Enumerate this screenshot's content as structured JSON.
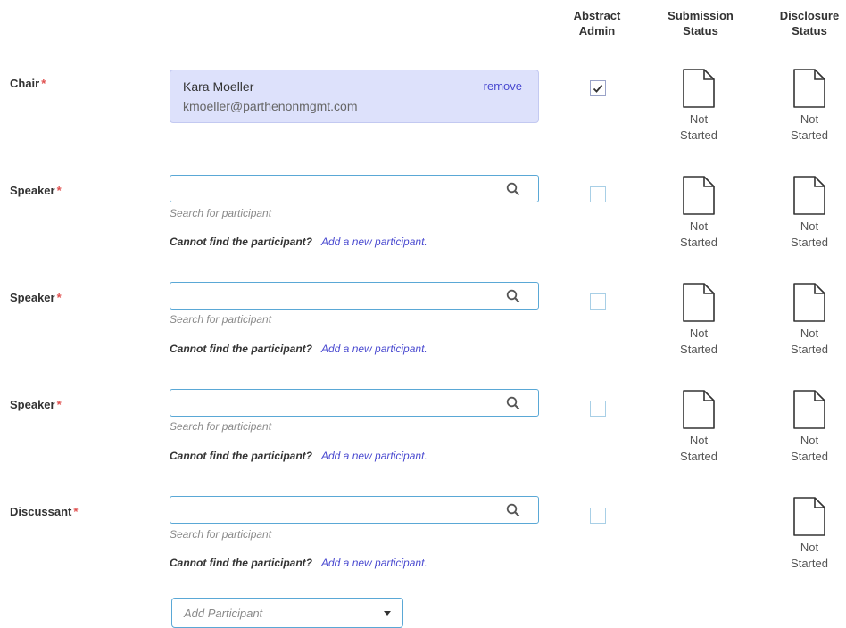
{
  "columns": {
    "abstract_admin": "Abstract\nAdmin",
    "submission_status": "Submission\nStatus",
    "disclosure_status": "Disclosure\nStatus"
  },
  "required_mark": "*",
  "chair": {
    "label": "Chair",
    "name": "Kara Moeller",
    "email": "kmoeller@parthenonmgmt.com",
    "remove_label": "remove",
    "abstract_admin_checked": true,
    "submission_status": "Not\nStarted",
    "disclosure_status": "Not\nStarted"
  },
  "slots": [
    {
      "label": "Speaker",
      "search_value": "",
      "hint": "Search for participant",
      "cannot_find": "Cannot find the participant?",
      "add_new": "Add a new participant.",
      "abstract_admin_checked": false,
      "submission_status": "Not\nStarted",
      "disclosure_status": "Not\nStarted"
    },
    {
      "label": "Speaker",
      "search_value": "",
      "hint": "Search for participant",
      "cannot_find": "Cannot find the participant?",
      "add_new": "Add a new participant.",
      "abstract_admin_checked": false,
      "submission_status": "Not\nStarted",
      "disclosure_status": "Not\nStarted"
    },
    {
      "label": "Speaker",
      "search_value": "",
      "hint": "Search for participant",
      "cannot_find": "Cannot find the participant?",
      "add_new": "Add a new participant.",
      "abstract_admin_checked": false,
      "submission_status": "Not\nStarted",
      "disclosure_status": "Not\nStarted"
    },
    {
      "label": "Discussant",
      "search_value": "",
      "hint": "Search for participant",
      "cannot_find": "Cannot find the participant?",
      "add_new": "Add a new participant.",
      "abstract_admin_checked": false,
      "submission_status": null,
      "disclosure_status": "Not\nStarted"
    }
  ],
  "add_participant": {
    "placeholder": "Add Participant"
  },
  "icons": {
    "search": "search-icon",
    "document": "document-icon",
    "check": "checkmark-icon",
    "caret": "chevron-down-icon"
  },
  "colors": {
    "accent_blue": "#5aa8d6",
    "link": "#4a4ad0",
    "required": "#e0504f",
    "chair_card": "#dde1fb"
  }
}
